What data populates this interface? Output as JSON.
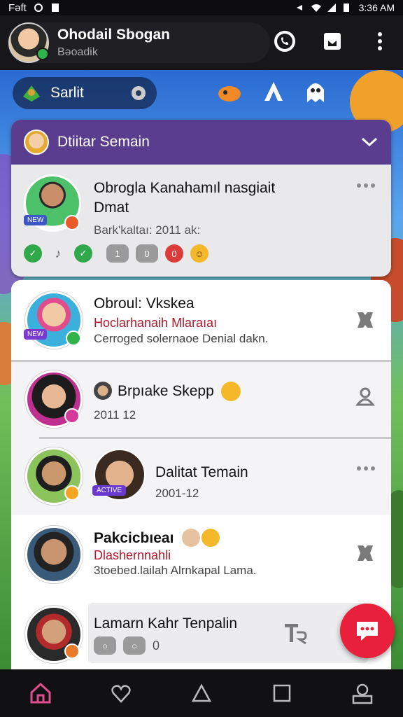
{
  "status_bar": {
    "left_text": "Fəft",
    "time": "3:36 AM"
  },
  "header": {
    "title": "Ohodail Sbogan",
    "subtitle": "Bəoadik"
  },
  "scene_bar": {
    "label": "Sarlit"
  },
  "group": {
    "header_title": "Dtiitar Semain",
    "item": {
      "name_line1": "Obrogla Kanahamıl nasgiait",
      "name_line2": "Dmat",
      "meta": "Bark'kaltaı: 2011 ak:",
      "badge": "NEW"
    }
  },
  "list": [
    {
      "name": "Obroul: Vkskea",
      "red_text": "Hoclarhanaih Mlaraıaı",
      "meta": "Cerroged solernaoe Denial dakn.",
      "badge": "NEW"
    },
    {
      "name": "Brpıake Skepp",
      "meta": "2011 12"
    },
    {
      "name": "Dalitat Temain",
      "meta": "2001-12",
      "badge": "ACTIVE"
    },
    {
      "name": "Pakcicbıeaı",
      "red_text": "Dlashernnahli",
      "meta": "3toebed.lailah Alrnkapal Lama."
    },
    {
      "name": "Lamarn Kahr Tenpalin",
      "chip_value": "0"
    }
  ],
  "colors": {
    "purple_header": "#5b3d8f",
    "fab": "#e8203b",
    "accent_red": "#b01a2a"
  }
}
